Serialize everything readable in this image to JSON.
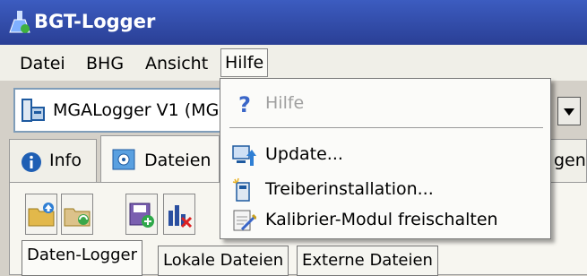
{
  "window": {
    "title": "BGT-Logger"
  },
  "menubar": {
    "items": [
      {
        "label": "Datei"
      },
      {
        "label": "BHG"
      },
      {
        "label": "Ansicht"
      },
      {
        "label": "Hilfe"
      }
    ]
  },
  "logger_select": {
    "value": "MGALogger V1 (MG"
  },
  "tabs": [
    {
      "label": "Info"
    },
    {
      "label": "Dateien"
    },
    {
      "label": "gen"
    }
  ],
  "subtabs": [
    {
      "label": "Daten-Logger"
    },
    {
      "label": "Lokale Dateien"
    },
    {
      "label": "Externe Dateien"
    }
  ],
  "help_menu": {
    "items": [
      {
        "label": "Hilfe",
        "icon": "question-icon",
        "disabled": true
      },
      {
        "label": "Update...",
        "icon": "update-icon"
      },
      {
        "label": "Treiberinstallation...",
        "icon": "driver-install-icon"
      },
      {
        "label": "Kalibrier-Modul freischalten",
        "icon": "calibration-unlock-icon"
      }
    ]
  },
  "colors": {
    "titlebar": "#2a3f95",
    "menu_bg": "#f0efe8",
    "disabled_text": "#a0a0a0"
  }
}
